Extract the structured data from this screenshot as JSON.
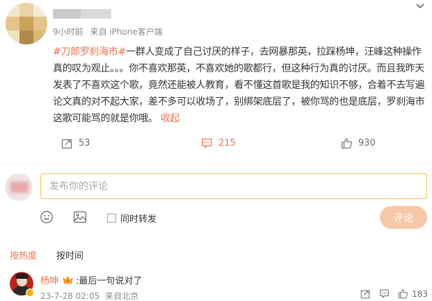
{
  "post": {
    "meta": {
      "time": "9小时前",
      "source": "来自 iPhone客户端"
    },
    "hashtag": "#刀郎罗刹海市#",
    "text": "一群人变成了自己讨厌的样子，去网暴那英，拉踩杨坤，汪峰这种操作真的叹为观止。。。你不喜欢那英，不喜欢她的歌都行，但这种行为真的讨厌。而且我昨天发表了不喜欢这个歌，竟然还能被人教育，看不懂这首歌是我的知识不够，合着不去写遍论文真的对不起大家，差不多可以收场了，别绑架底层了，被你骂的也是底层，罗刹海市这歌可能骂的就是你哦。",
    "fold_label": "收起",
    "repost_count": "53",
    "comment_count": "215",
    "like_count": "930"
  },
  "composer": {
    "placeholder": "发布你的评论",
    "repost_label": "同时转发",
    "submit_label": "评论"
  },
  "sort": {
    "tabs": [
      "按热度",
      "按时间"
    ],
    "active": 0
  },
  "comments": [
    {
      "name": "杨坤",
      "text": ":最后一句说对了",
      "date": "23-7-28 02:05",
      "location": "来自北京",
      "like_count": "183"
    }
  ],
  "colors": {
    "accent": "#eb7350",
    "input_border": "#f0c24c",
    "submit_bg": "#f6c8a7"
  }
}
